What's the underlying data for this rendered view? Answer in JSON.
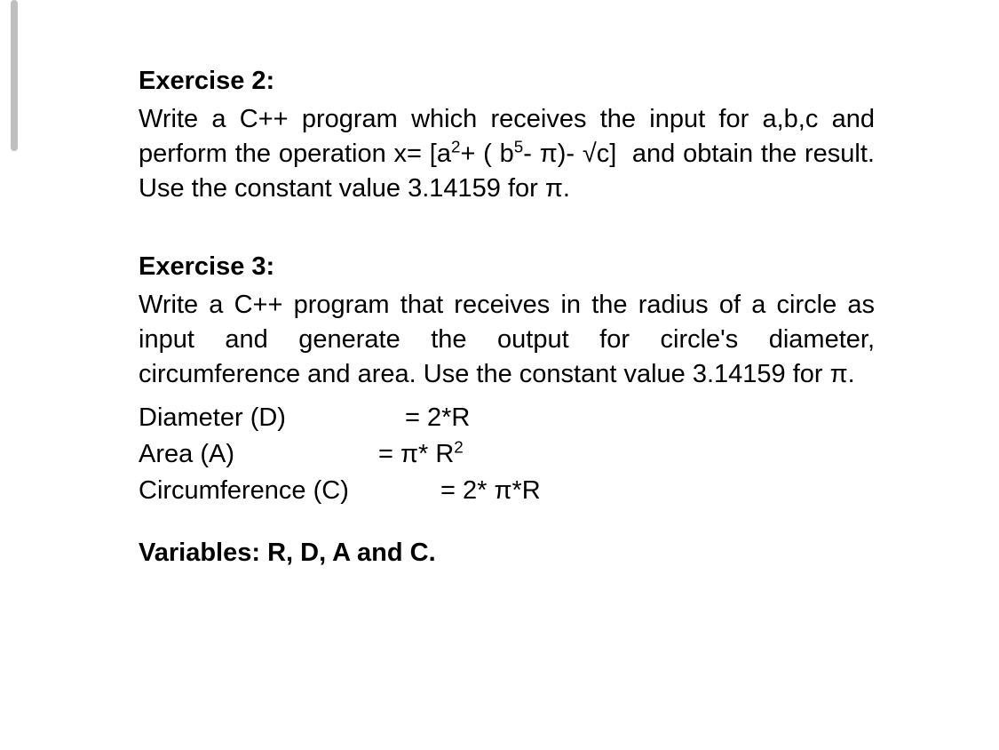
{
  "exercise2": {
    "title": "Exercise 2:",
    "body_html": "Write a C++ program which receives the input for a,b,c and perform the operation x= [a<sup>2</sup>+ ( b<sup>5</sup>- π)- √c] &nbsp;and obtain the result. Use the constant value 3.14159 for π."
  },
  "exercise3": {
    "title": "Exercise 3:",
    "body": "Write a C++ program that receives in the radius of a circle as input and generate the output for circle's diameter, circumference and area. Use the constant value 3.14159 for π.",
    "formulas": [
      {
        "label": "Diameter (D)",
        "value_html": "= 2*R",
        "wide": false
      },
      {
        "label": "Area (A)",
        "value_html": "= π* R<sup>2</sup>",
        "wide": false
      },
      {
        "label": "Circumference (C)",
        "value_html": "= 2* π*R",
        "wide": true
      }
    ],
    "variables": "Variables: R, D, A and C."
  }
}
